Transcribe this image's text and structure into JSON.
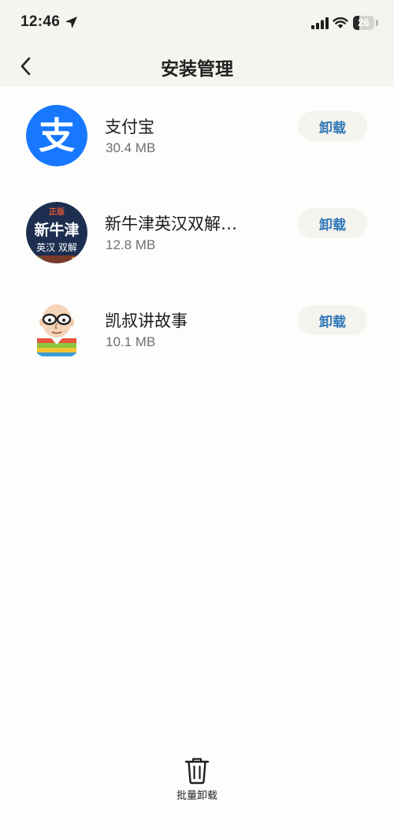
{
  "status_bar": {
    "time": "12:46",
    "battery": "26"
  },
  "header": {
    "title": "安装管理"
  },
  "apps": [
    {
      "name": "支付宝",
      "size": "30.4 MB",
      "action_label": "卸载",
      "icon": "alipay-icon",
      "icon_text": "支"
    },
    {
      "name": "新牛津英汉双解…",
      "size": "12.8 MB",
      "action_label": "卸载",
      "icon": "oxford-dictionary-icon",
      "icon_text_top": "正版",
      "icon_text_main": "新牛津",
      "icon_text_bottom": "英汉 双解"
    },
    {
      "name": "凯叔讲故事",
      "size": "10.1 MB",
      "action_label": "卸载",
      "icon": "kaishu-story-icon"
    }
  ],
  "footer": {
    "batch_label": "批量卸载"
  },
  "colors": {
    "accent": "#2f77b8",
    "alipay_blue": "#1777ff",
    "header_bg": "#f6f4ef"
  }
}
